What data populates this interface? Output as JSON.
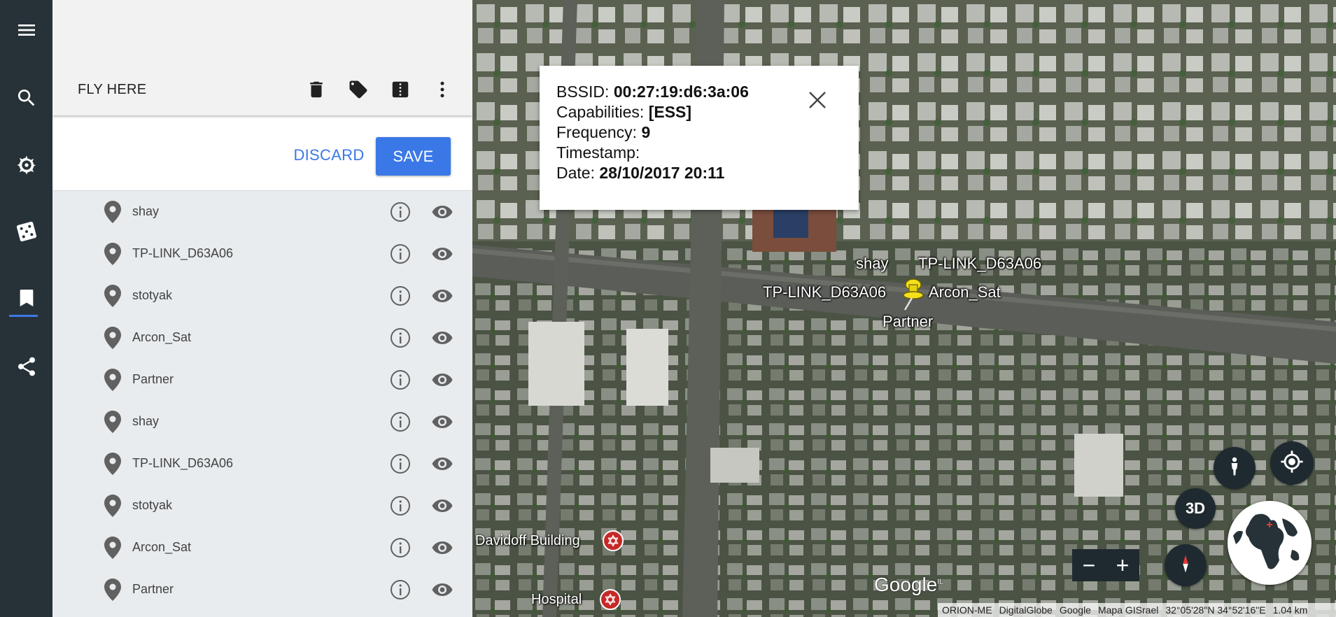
{
  "rail": {
    "items": [
      {
        "name": "menu-icon"
      },
      {
        "name": "search-icon"
      },
      {
        "name": "voyager-icon"
      },
      {
        "name": "feeling-lucky-icon"
      },
      {
        "name": "projects-icon",
        "active": true
      },
      {
        "name": "share-icon"
      }
    ],
    "accent_color": "#3b78e7",
    "background": "#263238"
  },
  "panel": {
    "header": {
      "title": "FLY HERE",
      "icons": [
        "delete-icon",
        "label-icon",
        "presentation-icon",
        "more-vert-icon"
      ]
    },
    "actions": {
      "discard_label": "DISCARD",
      "save_label": "SAVE"
    },
    "items": [
      {
        "label": "shay"
      },
      {
        "label": "TP-LINK_D63A06"
      },
      {
        "label": "stotyak"
      },
      {
        "label": "Arcon_Sat"
      },
      {
        "label": "Partner"
      },
      {
        "label": "shay"
      },
      {
        "label": "TP-LINK_D63A06"
      },
      {
        "label": "stotyak"
      },
      {
        "label": "Arcon_Sat"
      },
      {
        "label": "Partner"
      }
    ]
  },
  "balloon": {
    "bssid_label": "BSSID: ",
    "bssid_value": "00:27:19:d6:3a:06",
    "capabilities_label": "Capabilities: ",
    "capabilities_value": "[ESS]",
    "frequency_label": "Frequency: ",
    "frequency_value": "9",
    "timestamp_label": "Timestamp:",
    "date_label": "Date: ",
    "date_value": "28/10/2017 20:11"
  },
  "map": {
    "labels": {
      "shay": "shay",
      "tp_top": "TP-LINK_D63A06",
      "tp_left": "TP-LINK_D63A06",
      "arcon": "Arcon_Sat",
      "partner": "Partner"
    },
    "pois": {
      "davidoff": "Davidoff Building",
      "hospital": "Hospital"
    },
    "controls": {
      "three_d_label": "3D",
      "zoom_out": "−",
      "zoom_in": "+"
    },
    "google_logo": "Google",
    "google_logo_sup": "IL",
    "attribution": [
      "ORION-ME",
      "DigitalGlobe",
      "Google",
      "Mapa GISrael",
      "32°05'28\"N 34°52'16\"E",
      "1.04 km"
    ]
  }
}
